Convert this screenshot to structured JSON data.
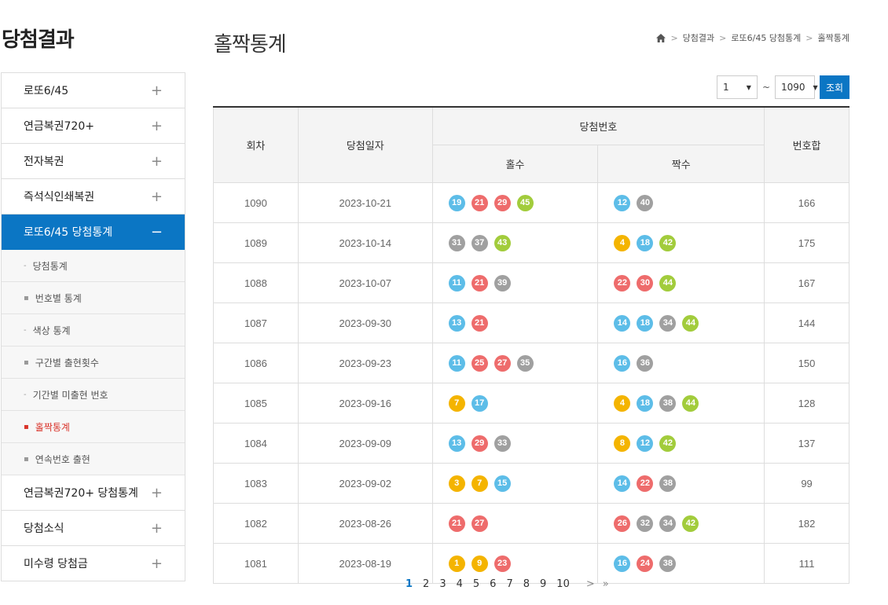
{
  "lnb": {
    "title": "당첨결과",
    "menu": [
      {
        "label": "로또6/45",
        "icon": "+"
      },
      {
        "label": "연금복권720+",
        "icon": "+"
      },
      {
        "label": "전자복권",
        "icon": "+"
      },
      {
        "label": "즉석식인쇄복권",
        "icon": "+"
      },
      {
        "label": "로또6/45 당첨통계",
        "icon": "−"
      }
    ],
    "sub": [
      {
        "label": "당첨통계"
      },
      {
        "label": "번호별 통계"
      },
      {
        "label": "색상 통계"
      },
      {
        "label": "구간별 출현횟수"
      },
      {
        "label": "기간별 미출현 번호"
      },
      {
        "label": "홀짝통계"
      },
      {
        "label": "연속번호 출현"
      }
    ],
    "menu2": [
      {
        "label": "연금복권720+ 당첨통계",
        "icon": "+"
      },
      {
        "label": "당첨소식",
        "icon": "+"
      },
      {
        "label": "미수령 당첨금",
        "icon": "+"
      }
    ]
  },
  "page": {
    "title": "홀짝통계"
  },
  "breadcrumb": {
    "items": [
      "당첨결과",
      "로또6/45 당첨통계",
      "홀짝통계"
    ],
    "sep": ">"
  },
  "filter": {
    "from": "1",
    "tilde": "~",
    "to": "1090",
    "arrow": "▼",
    "search": "조회"
  },
  "table": {
    "h_round": "회차",
    "h_date": "당첨일자",
    "h_numbers": "당첨번호",
    "h_odd": "홀수",
    "h_even": "짝수",
    "h_sum": "번호합",
    "rows": [
      {
        "round": "1090",
        "date": "2023-10-21",
        "odd": [
          19,
          21,
          29,
          45
        ],
        "even": [
          12,
          40
        ],
        "sum": "166"
      },
      {
        "round": "1089",
        "date": "2023-10-14",
        "odd": [
          31,
          37,
          43
        ],
        "even": [
          4,
          18,
          42
        ],
        "sum": "175"
      },
      {
        "round": "1088",
        "date": "2023-10-07",
        "odd": [
          11,
          21,
          39
        ],
        "even": [
          22,
          30,
          44
        ],
        "sum": "167"
      },
      {
        "round": "1087",
        "date": "2023-09-30",
        "odd": [
          13,
          21
        ],
        "even": [
          14,
          18,
          34,
          44
        ],
        "sum": "144"
      },
      {
        "round": "1086",
        "date": "2023-09-23",
        "odd": [
          11,
          25,
          27,
          35
        ],
        "even": [
          16,
          36
        ],
        "sum": "150"
      },
      {
        "round": "1085",
        "date": "2023-09-16",
        "odd": [
          7,
          17
        ],
        "even": [
          4,
          18,
          38,
          44
        ],
        "sum": "128"
      },
      {
        "round": "1084",
        "date": "2023-09-09",
        "odd": [
          13,
          29,
          33
        ],
        "even": [
          8,
          12,
          42
        ],
        "sum": "137"
      },
      {
        "round": "1083",
        "date": "2023-09-02",
        "odd": [
          3,
          7,
          15
        ],
        "even": [
          14,
          22,
          38
        ],
        "sum": "99"
      },
      {
        "round": "1082",
        "date": "2023-08-26",
        "odd": [
          21,
          27
        ],
        "even": [
          26,
          32,
          34,
          42
        ],
        "sum": "182"
      },
      {
        "round": "1081",
        "date": "2023-08-19",
        "odd": [
          1,
          9,
          23
        ],
        "even": [
          16,
          24,
          38
        ],
        "sum": "111"
      }
    ]
  },
  "ball_colors": {
    "1-10": "#f4b400",
    "11-20": "#5dbde8",
    "21-30": "#ee6c6c",
    "31-40": "#a0a0a0",
    "41-45": "#a2cc3c"
  },
  "paging": {
    "pages": [
      "1",
      "2",
      "3",
      "4",
      "5",
      "6",
      "7",
      "8",
      "9",
      "10"
    ],
    "current": "1",
    "next": ">",
    "last": "»"
  }
}
